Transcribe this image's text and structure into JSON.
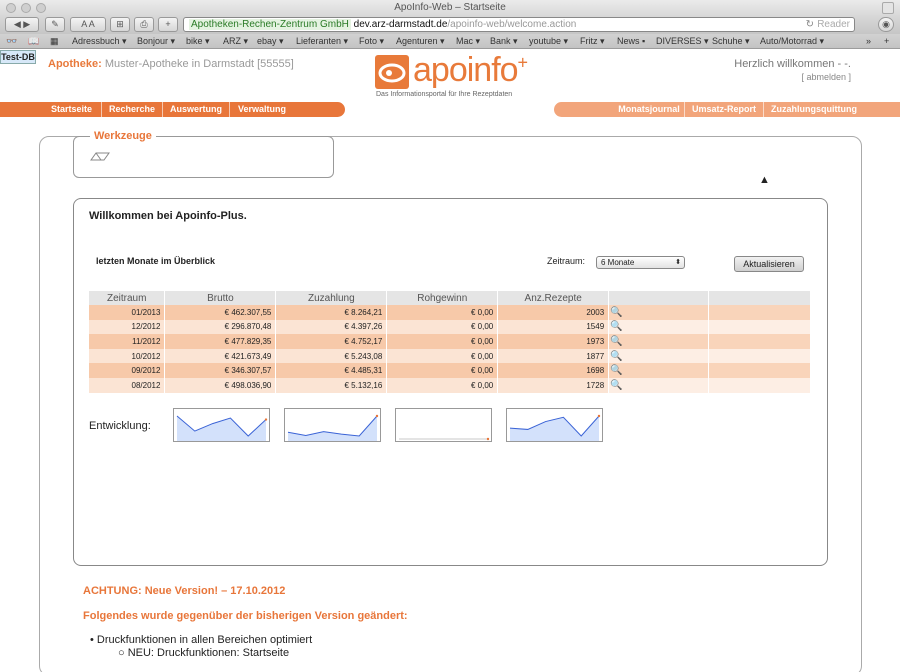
{
  "browser": {
    "title": "ApoInfo-Web – Startseite",
    "url_secure": "Apotheken-Rechen-Zentrum GmbH",
    "url_host": "dev.arz-darmstadt.de",
    "url_path": "/apoinfo-web/welcome.action",
    "reader": "Reader",
    "bookmarks": [
      "Adressbuch ▾",
      "Bonjour ▾",
      "bike ▾",
      "ARZ ▾",
      "ebay ▾",
      "Lieferanten ▾",
      "Foto ▾",
      "Agenturen ▾",
      "Mac ▾",
      "Bank ▾",
      "youtube ▾",
      "Fritz ▾",
      "News ▪",
      "DIVERSES ▾",
      "Schuhe ▾",
      "Auto/Motorrad ▾",
      "»"
    ]
  },
  "header": {
    "testdb": "Test-DB",
    "apotheke_label": "Apotheke:",
    "apotheke_name": "Muster-Apotheke in Darmstadt [55555]",
    "logo_text": "apoinfo",
    "logo_plus": "+",
    "logo_tagline": "Das Informationsportal für Ihre Rezeptdaten",
    "welcome": "Herzlich willkommen - -.",
    "logout": "[ abmelden ]"
  },
  "nav": {
    "left": [
      "Startseite",
      "Recherche",
      "Auswertung",
      "Verwaltung"
    ],
    "right": [
      "Monatsjournal",
      "Umsatz-Report",
      "Zuzahlungsquittung"
    ]
  },
  "tools": {
    "title": "Werkzeuge"
  },
  "panel": {
    "title": "Willkommen bei Apoinfo-Plus.",
    "subtitle": "letzten Monate im Überblick",
    "zeitraum_label": "Zeitraum:",
    "zeitraum_value": "6 Monate",
    "refresh": "Aktualisieren",
    "columns": [
      "Zeitraum",
      "Brutto",
      "Zuzahlung",
      "Rohgewinn",
      "Anz.Rezepte"
    ],
    "rows": [
      [
        "01/2013",
        "€ 462.307,55",
        "€ 8.264,21",
        "€ 0,00",
        "2003"
      ],
      [
        "12/2012",
        "€ 296.870,48",
        "€ 4.397,26",
        "€ 0,00",
        "1549"
      ],
      [
        "11/2012",
        "€ 477.829,35",
        "€ 4.752,17",
        "€ 0,00",
        "1973"
      ],
      [
        "10/2012",
        "€ 421.673,49",
        "€ 5.243,08",
        "€ 0,00",
        "1877"
      ],
      [
        "09/2012",
        "€ 346.307,57",
        "€ 4.485,31",
        "€ 0,00",
        "1698"
      ],
      [
        "08/2012",
        "€ 498.036,90",
        "€ 5.132,16",
        "€ 0,00",
        "1728"
      ]
    ],
    "entwicklung": "Entwicklung:"
  },
  "notice": {
    "heading": "ACHTUNG: Neue Version! – 17.10.2012",
    "changes": "Folgendes wurde gegenüber der bisherigen Version geändert:",
    "item1": "Druckfunktionen in allen Bereichen optimiert",
    "item2": "NEU: Druckfunktionen: Startseite"
  },
  "colors": {
    "accent": "#e8763a",
    "accent_light": "#f2a57b",
    "row_odd": "#f7c9a9",
    "row_even": "#fbe4d4"
  }
}
